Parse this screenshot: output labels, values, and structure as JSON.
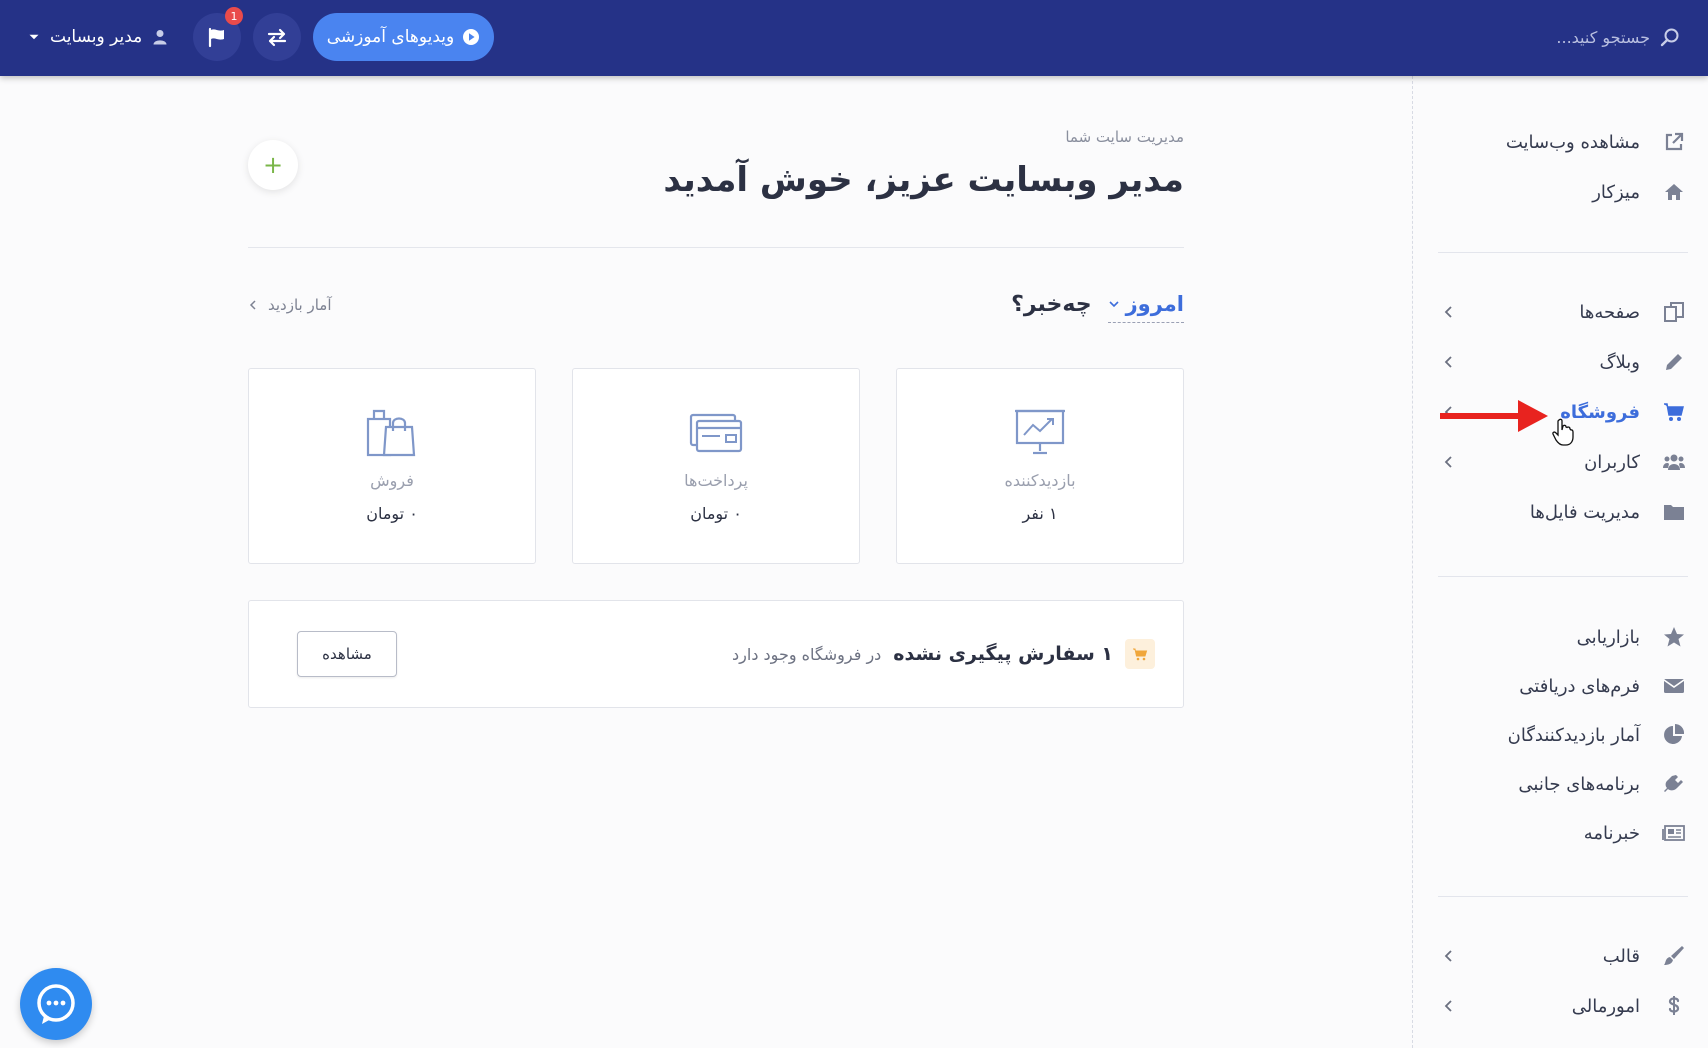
{
  "topbar": {
    "search_placeholder": "جستجو کنید...",
    "user_name": "مدیر وبسایت",
    "flag_badge": "1",
    "video_button": "ویدیوهای آموزشی"
  },
  "sidebar": {
    "group1": [
      {
        "label": "مشاهده وب‌سایت",
        "icon": "external-link-icon"
      },
      {
        "label": "میزکار",
        "icon": "home-icon"
      }
    ],
    "group2": [
      {
        "label": "صفحه‌ها",
        "icon": "pages-icon"
      },
      {
        "label": "وبلاگ",
        "icon": "pencil-icon"
      },
      {
        "label": "فروشگاه",
        "icon": "cart-icon"
      },
      {
        "label": "کاربران",
        "icon": "users-icon"
      },
      {
        "label": "مدیریت فایل‌ها",
        "icon": "folder-icon"
      }
    ],
    "group3": [
      {
        "label": "بازاریابی",
        "icon": "star-icon"
      },
      {
        "label": "فرم‌های دریافتی",
        "icon": "envelope-icon"
      },
      {
        "label": "آمار بازدیدکنندگان",
        "icon": "pie-chart-icon"
      },
      {
        "label": "برنامه‌های جانبی",
        "icon": "plug-icon"
      },
      {
        "label": "خبرنامه",
        "icon": "newspaper-icon"
      }
    ],
    "group4": [
      {
        "label": "قالب",
        "icon": "brush-icon"
      },
      {
        "label": "امورمالی",
        "icon": "dollar-icon"
      }
    ],
    "active": "فروشگاه"
  },
  "main": {
    "subtitle": "مدیریت سایت شما",
    "welcome": "مدیر وبسایت عزیز، خوش آمدید",
    "whats_new": "چه‌خبر؟",
    "period": "امروز",
    "stats_link": "آمار بازدید",
    "cards": {
      "visitors": {
        "label": "بازدیدکننده",
        "value": "۱ نفر"
      },
      "payments": {
        "label": "پرداخت‌ها",
        "value": "۰ تومان"
      },
      "sales": {
        "label": "فروش",
        "value": "۰ تومان"
      }
    },
    "orders": {
      "strong": "۱ سفارش پیگیری نشده",
      "rest": "در فروشگاه وجود دارد",
      "view_button": "مشاهده"
    }
  },
  "colors": {
    "topbar": "#253287",
    "accent": "#3d6ddb",
    "video_button": "#4a84f0",
    "annotation_arrow": "#e8231f",
    "chat": "#2f8bf0"
  }
}
